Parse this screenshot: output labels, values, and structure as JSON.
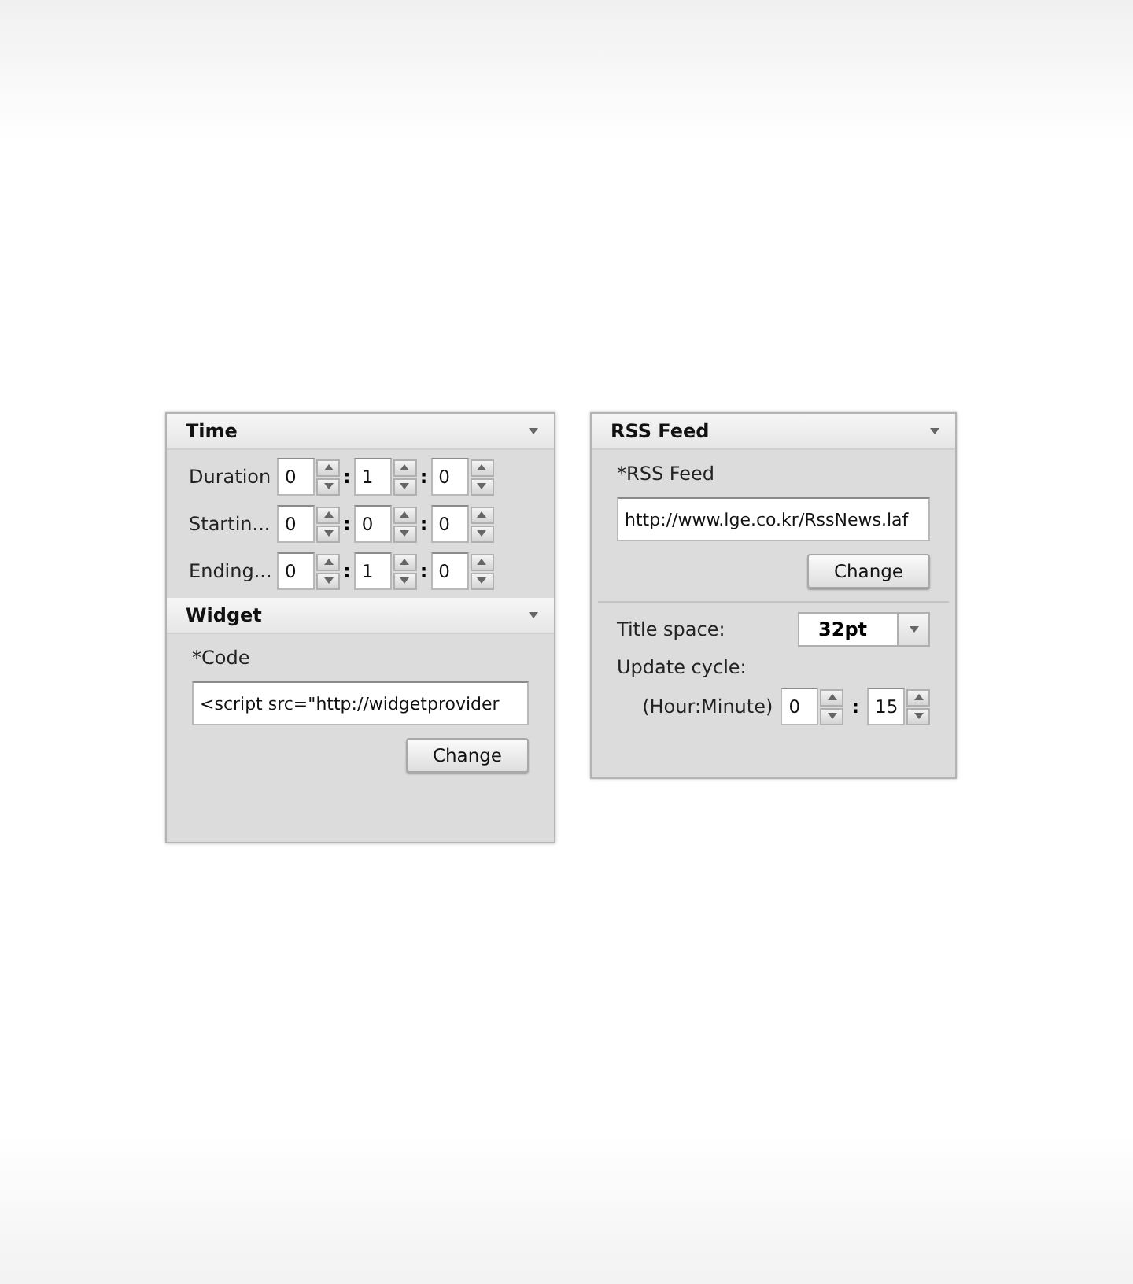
{
  "panels": [
    {
      "sections": [
        {
          "kind": "time",
          "title": "Time",
          "separator": ":",
          "rows": [
            {
              "label": "Duration",
              "values": [
                "0",
                "1",
                "0"
              ]
            },
            {
              "label": "Startin...",
              "values": [
                "0",
                "0",
                "0"
              ]
            },
            {
              "label": "Ending...",
              "values": [
                "0",
                "1",
                "0"
              ]
            }
          ]
        },
        {
          "kind": "code",
          "title": "Widget",
          "field_label": "*Code",
          "value": "<script src=\"http://widgetprovider",
          "button": "Change"
        }
      ]
    },
    {
      "sections": [
        {
          "kind": "rss",
          "title": "RSS Feed",
          "field_label": "*RSS Feed",
          "value": "http://www.lge.co.kr/RssNews.laf",
          "button": "Change",
          "title_space_label": "Title space:",
          "title_space_value": "32pt",
          "update_cycle_label": "Update cycle:",
          "cycle_unit_label": "(Hour:Minute)",
          "separator": ":",
          "cycle_values": [
            "0",
            "15"
          ]
        }
      ]
    }
  ]
}
